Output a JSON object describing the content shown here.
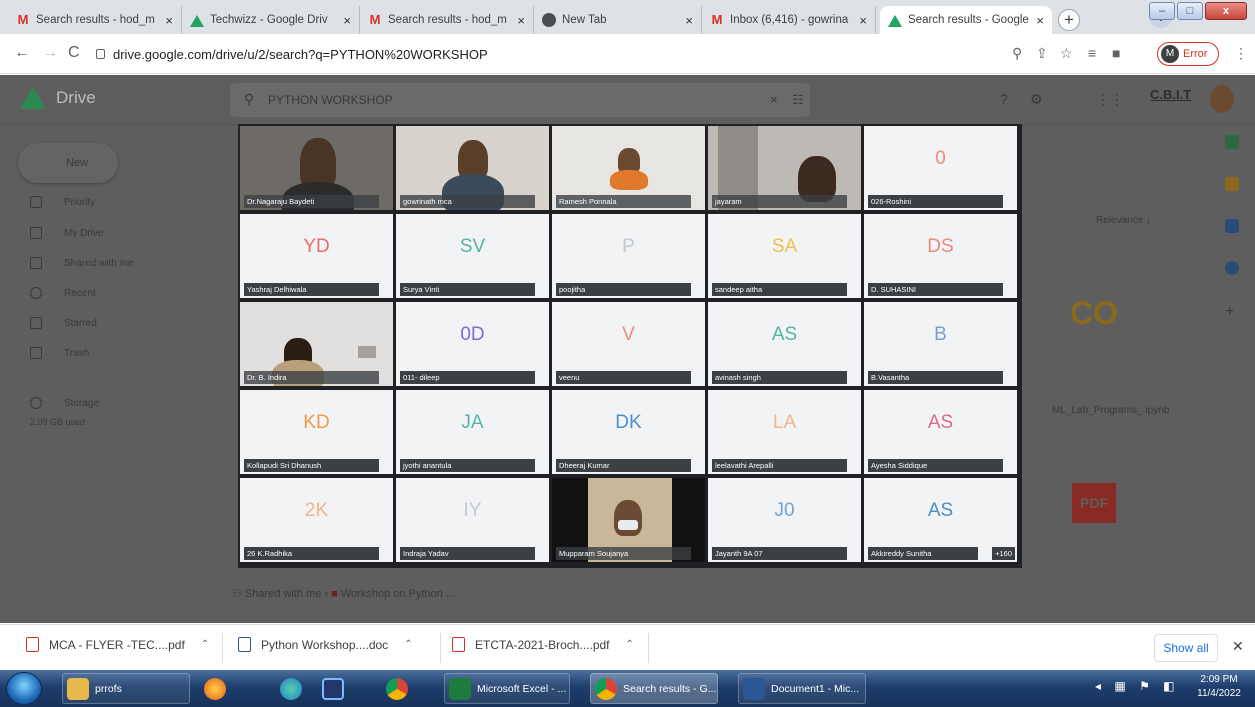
{
  "browser": {
    "tabs": [
      {
        "title": "Search results - hod_m",
        "icon": "gmail-icon"
      },
      {
        "title": "Techwizz - Google Driv",
        "icon": "drive-icon"
      },
      {
        "title": "Search results - hod_m",
        "icon": "gmail-icon"
      },
      {
        "title": "New Tab",
        "icon": "chrome-icon"
      },
      {
        "title": "Inbox (6,416) - gowrina",
        "icon": "gmail-icon"
      },
      {
        "title": "Search results - Google",
        "icon": "drive-icon",
        "active": true
      }
    ],
    "new_tab": "+",
    "url": "drive.google.com/drive/u/2/search?q=PYTHON%20WORKSHOP",
    "profile_initial": "M",
    "profile_status": "Error"
  },
  "drive": {
    "logo_text": "Drive",
    "search_query": "PYTHON WORKSHOP",
    "org_badge": "C.B.I.T",
    "new_label": "New",
    "nav": [
      "Priority",
      "My Drive",
      "Shared with me",
      "Recent",
      "Starred",
      "Trash",
      "Storage"
    ],
    "storage_text": "2.09 GB used",
    "sort_label": "Relevance",
    "file_name": "ML_Lab_Programs_.ipynb",
    "breadcrumb_root": "Shared with me",
    "breadcrumb_folder": "Workshop on Python ..."
  },
  "meeting": {
    "tiles": [
      {
        "name": "Dr.Nagaraju Baydeti",
        "video": true
      },
      {
        "name": "gowrinath mca",
        "video": true
      },
      {
        "name": "Ramesh Ponnala",
        "video": true
      },
      {
        "name": "jayaram",
        "video": true
      },
      {
        "name": "026-Roshini",
        "initials": "0"
      },
      {
        "name": "Yashraj Delhiwala",
        "initials": "YD"
      },
      {
        "name": "Surya Vinti",
        "initials": "SV"
      },
      {
        "name": "poojitha",
        "initials": "P"
      },
      {
        "name": "sandeep aitha",
        "initials": "SA"
      },
      {
        "name": "D. SUHASINI",
        "initials": "DS"
      },
      {
        "name": "Dr. B. Indira",
        "video": true
      },
      {
        "name": "011- dileep",
        "initials": "0D"
      },
      {
        "name": "veenu",
        "initials": "V"
      },
      {
        "name": "avinash singh",
        "initials": "AS"
      },
      {
        "name": "B.Vasantha",
        "initials": "B"
      },
      {
        "name": "Kollapudi Sri Dhanush",
        "initials": "KD"
      },
      {
        "name": "jyothi anantula",
        "initials": "JA"
      },
      {
        "name": "Dheeraj Kumar",
        "initials": "DK"
      },
      {
        "name": "leelavathi Arepalli",
        "initials": "LA"
      },
      {
        "name": "Ayesha Siddique",
        "initials": "AS"
      },
      {
        "name": "26 K.Radhika",
        "initials": "2K"
      },
      {
        "name": "Indraja Yadav",
        "initials": "IY"
      },
      {
        "name": "Mupparam Soujanya",
        "video": true
      },
      {
        "name": "Jayanth 9A 07",
        "initials": "J0"
      },
      {
        "name": "Akkireddy Sunitha",
        "initials": "AS"
      }
    ],
    "extra_count": "+160"
  },
  "downloads": {
    "items": [
      {
        "name": "MCA - FLYER -TEC....pdf",
        "type": "pdf"
      },
      {
        "name": "Python Workshop....doc",
        "type": "doc"
      },
      {
        "name": "ETCTA-2021-Broch....pdf",
        "type": "pdf"
      }
    ],
    "show_all": "Show all"
  },
  "taskbar": {
    "items": [
      {
        "label": "prrofs"
      },
      {
        "label": ""
      },
      {
        "label": ""
      },
      {
        "label": ""
      },
      {
        "label": ""
      },
      {
        "label": "Microsoft Excel - ..."
      },
      {
        "label": "Search results - G..."
      },
      {
        "label": "Document1 - Mic..."
      }
    ],
    "time": "2:09 PM",
    "date": "11/4/2022"
  }
}
